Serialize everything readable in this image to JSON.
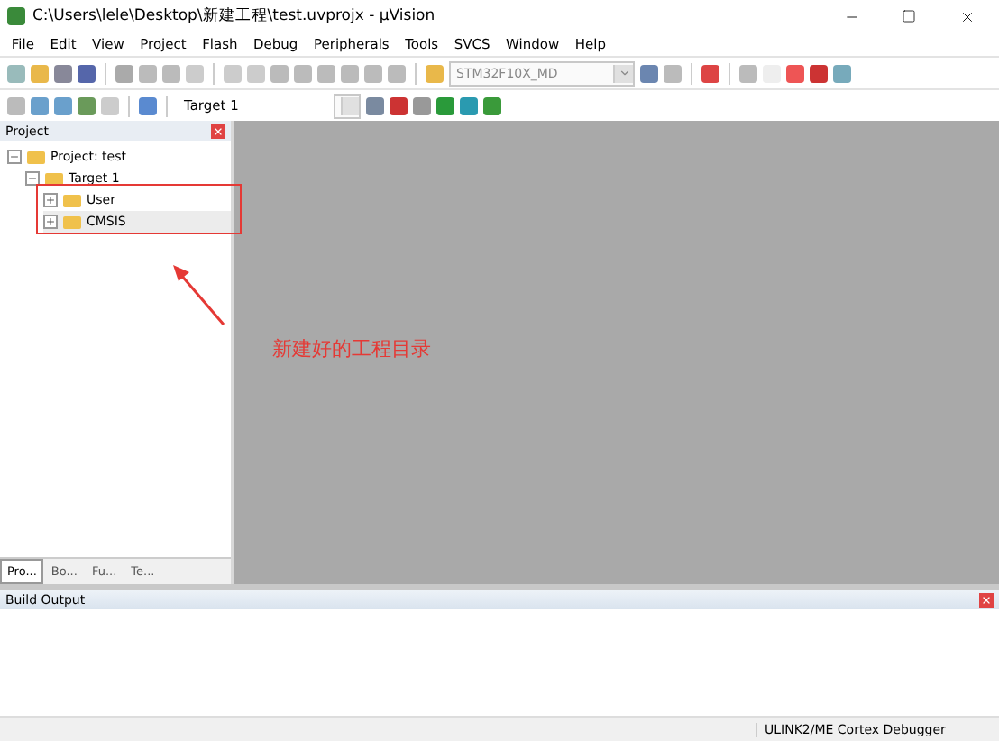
{
  "window": {
    "title": "C:\\Users\\lele\\Desktop\\新建工程\\test.uvprojx - µVision"
  },
  "menu": [
    "File",
    "Edit",
    "View",
    "Project",
    "Flash",
    "Debug",
    "Peripherals",
    "Tools",
    "SVCS",
    "Window",
    "Help"
  ],
  "toolbar": {
    "device": "STM32F10X_MD"
  },
  "build_toolbar": {
    "target": "Target 1"
  },
  "project_panel": {
    "title": "Project",
    "tree": [
      {
        "label": "Project: test",
        "expanded": true,
        "selected": false,
        "children": [
          {
            "label": "Target 1",
            "expanded": true,
            "selected": false,
            "children": [
              {
                "label": "User",
                "expanded": false,
                "selected": false
              },
              {
                "label": "CMSIS",
                "expanded": false,
                "selected": true
              }
            ]
          }
        ]
      }
    ],
    "tabs": [
      {
        "label": "Pro...",
        "selected": true
      },
      {
        "label": "Bo...",
        "selected": false
      },
      {
        "label": "Fu...",
        "selected": false
      },
      {
        "label": "Te...",
        "selected": false
      }
    ]
  },
  "annotation": {
    "text": "新建好的工程目录"
  },
  "build_output": {
    "title": "Build Output"
  },
  "status_bar": {
    "debugger": "ULINK2/ME Cortex Debugger"
  }
}
